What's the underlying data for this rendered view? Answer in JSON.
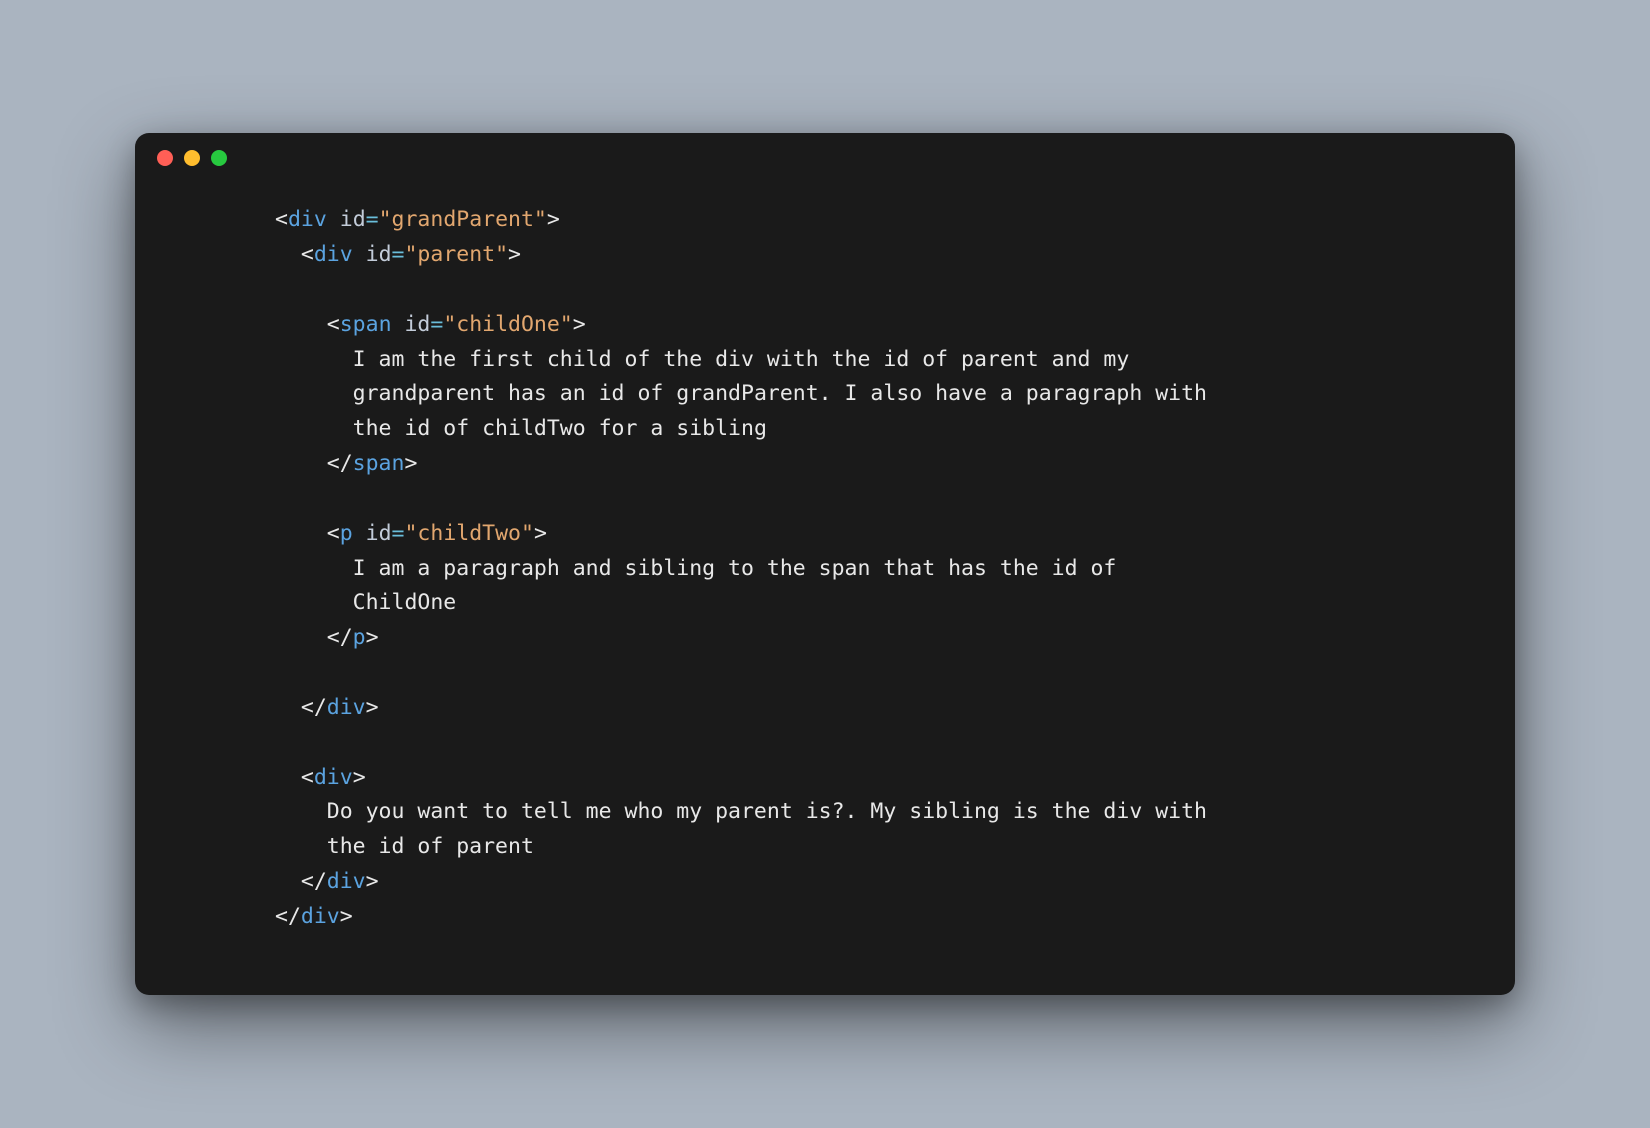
{
  "code": {
    "tags": {
      "div": "div",
      "span": "span",
      "p": "p"
    },
    "attrs": {
      "id": "id"
    },
    "values": {
      "grandParent": "\"grandParent\"",
      "parent": "\"parent\"",
      "childOne": "\"childOne\"",
      "childTwo": "\"childTwo\""
    },
    "text": {
      "childOne_l1": "I am the first child of the div with the id of parent and my",
      "childOne_l2": "grandparent has an id of grandParent. I also have a paragraph with",
      "childOne_l3": "the id of childTwo for a sibling",
      "childTwo_l1": "I am a paragraph and sibling to the span that has the id of",
      "childTwo_l2": "ChildOne",
      "div2_l1": "Do you want to tell me who my parent is?. My sibling is the div with",
      "div2_l2": "the id of parent"
    },
    "punct": {
      "lt": "<",
      "gt": ">",
      "lts": "</",
      "eq": "="
    }
  }
}
